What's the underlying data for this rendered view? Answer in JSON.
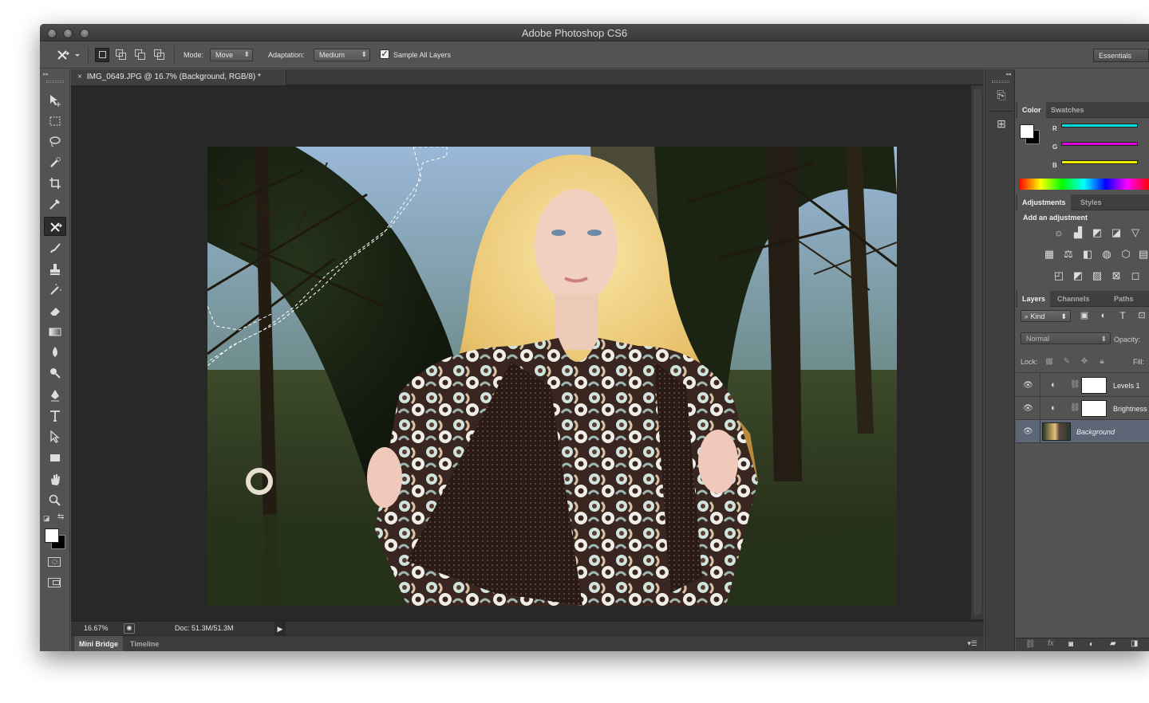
{
  "app": {
    "title": "Adobe Photoshop CS6"
  },
  "options_bar": {
    "mode_label": "Mode:",
    "mode_value": "Move",
    "adaptation_label": "Adaptation:",
    "adaptation_value": "Medium",
    "sample_all_layers_label": "Sample All Layers",
    "sample_all_layers_checked": true,
    "workspace": "Essentials"
  },
  "document": {
    "tab_title": "IMG_0649.JPG @ 16.7% (Background, RGB/8) *",
    "close_glyph": "×"
  },
  "status": {
    "zoom": "16.67%",
    "doc_size": "Doc: 51.3M/51.3M"
  },
  "bottom_panels": {
    "tabs": [
      "Mini Bridge",
      "Timeline"
    ],
    "active": "Mini Bridge"
  },
  "color_panel": {
    "tabs": [
      "Color",
      "Swatches"
    ],
    "active": "Color",
    "channels": [
      {
        "label": "R",
        "color": "#00e5e5"
      },
      {
        "label": "G",
        "color": "#e000e0"
      },
      {
        "label": "B",
        "color": "#f0f000"
      }
    ],
    "foreground": "#ffffff",
    "background": "#000000"
  },
  "adjustments_panel": {
    "tabs": [
      "Adjustments",
      "Styles"
    ],
    "active": "Adjustments",
    "heading": "Add an adjustment"
  },
  "layers_panel": {
    "tabs": [
      "Layers",
      "Channels",
      "Paths"
    ],
    "active": "Layers",
    "filter_label": "Kind",
    "blend_mode": "Normal",
    "opacity_label": "Opacity:",
    "lock_label": "Lock:",
    "fill_label": "Fill:",
    "layers": [
      {
        "name": "Levels 1",
        "visible": true,
        "selected": false
      },
      {
        "name": "Brightness",
        "visible": true,
        "selected": false
      },
      {
        "name": "Background",
        "visible": true,
        "selected": true
      }
    ]
  },
  "tools": [
    "move-tool",
    "marquee-tool",
    "lasso-tool",
    "quick-selection-tool",
    "crop-tool",
    "eyedropper-tool",
    "content-aware-move-tool",
    "brush-tool",
    "clone-stamp-tool",
    "history-brush-tool",
    "eraser-tool",
    "gradient-tool",
    "blur-tool",
    "dodge-tool",
    "pen-tool",
    "type-tool",
    "path-selection-tool",
    "rectangle-tool",
    "hand-tool",
    "zoom-tool"
  ],
  "active_tool": "content-aware-move-tool",
  "accent_colors": {
    "selected_layer": "#5d6677",
    "panel_bg": "#535353",
    "canvas_bg": "#282828"
  }
}
